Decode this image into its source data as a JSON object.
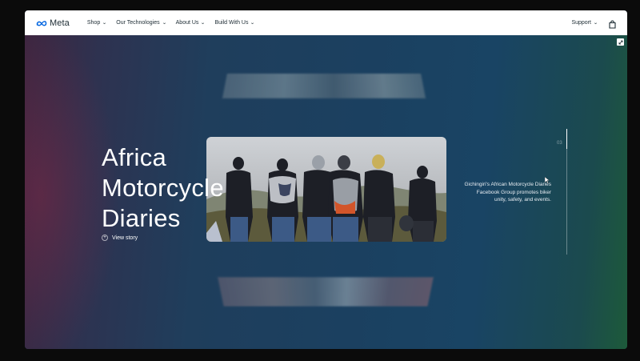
{
  "nav": {
    "logo_text": "Meta",
    "menu": [
      {
        "label": "Shop"
      },
      {
        "label": "Our Technologies"
      },
      {
        "label": "About Us"
      },
      {
        "label": "Build With Us"
      }
    ],
    "support_label": "Support",
    "chevron_glyph": "⌄"
  },
  "hero": {
    "title": "Africa\nMotorcycle\nDiaries",
    "cta_label": "View story",
    "caption": "Gichingiri's African Motorcycle Diaries Facebook Group promotes biker unity, safety, and events.",
    "slide_number": "03",
    "progress": 0.16
  },
  "icons": {
    "logo": "meta-infinity-icon",
    "chevron": "chevron-down-icon",
    "bag": "shopping-bag-icon",
    "expand": "expand-icon",
    "plus": "plus-circle-icon"
  },
  "colors": {
    "nav_bg": "#ffffff",
    "text_dark": "#1c2b33",
    "meta_blue": "#0668e1",
    "hero_text": "#ffffff"
  }
}
